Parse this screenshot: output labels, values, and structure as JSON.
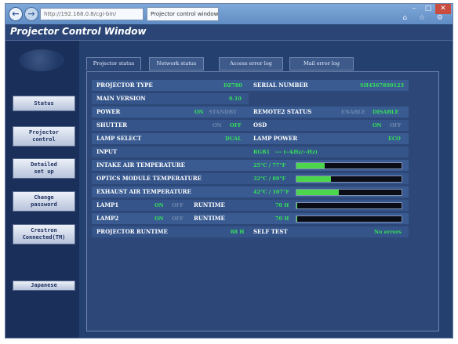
{
  "browser": {
    "address": "http://192.168.0.8/cgi-bin/",
    "tab_title": "Projector control window",
    "back_glyph": "←",
    "forward_glyph": "→",
    "minimize_glyph": "–",
    "maximize_glyph": "□",
    "close_glyph": "✕",
    "tool_glyphs": "⌂ ☆ ⚙"
  },
  "window_title": "Projector Control Window",
  "sidebar": {
    "buttons": [
      {
        "label": "Status"
      },
      {
        "label": "Projector\ncontrol"
      },
      {
        "label": "Detailed\nset up"
      },
      {
        "label": "Change\npassword"
      },
      {
        "label": "Crestron\nConnected(TM)"
      },
      {
        "label": "Japanese"
      }
    ]
  },
  "tabs": [
    "Projector status",
    "Network status",
    "Access error log",
    "Mail error log"
  ],
  "status": {
    "projector_type": {
      "label": "PROJECTOR TYPE",
      "value": "DZ780"
    },
    "serial_number": {
      "label": "SERIAL NUMBER",
      "value": "SH4567890123"
    },
    "main_version": {
      "label": "MAIN VERSION",
      "value": "0.10"
    },
    "power": {
      "label": "POWER",
      "on": "ON",
      "standby": "STANDBY"
    },
    "remote2": {
      "label": "REMOTE2 STATUS",
      "enable": "ENABLE",
      "disable": "DISABLE"
    },
    "shutter": {
      "label": "SHUTTER",
      "on": "ON",
      "off": "OFF"
    },
    "osd": {
      "label": "OSD",
      "on": "ON",
      "off": "OFF"
    },
    "lamp_select": {
      "label": "LAMP SELECT",
      "value": "DUAL"
    },
    "lamp_power": {
      "label": "LAMP POWER",
      "value": "ECO"
    },
    "input": {
      "label": "INPUT",
      "value": "RGB1",
      "freq": "--- (--kHz/--Hz)"
    },
    "intake": {
      "label": "INTAKE AIR TEMPERATURE",
      "value": "25°C / 77°F",
      "level": 0.27
    },
    "optics": {
      "label": "OPTICS MODULE TEMPERATURE",
      "value": "32°C / 89°F",
      "level": 0.33
    },
    "exhaust": {
      "label": "EXHAUST AIR TEMPERATURE",
      "value": "42°C / 107°F",
      "level": 0.4
    },
    "lamp1": {
      "label": "LAMP1",
      "on": "ON",
      "off": "OFF",
      "runtime_label": "RUNTIME",
      "runtime": "70 H",
      "level": 0.01
    },
    "lamp2": {
      "label": "LAMP2",
      "on": "ON",
      "off": "OFF",
      "runtime_label": "RUNTIME",
      "runtime": "70 H",
      "level": 0.01
    },
    "projector_runtime": {
      "label": "PROJECTOR RUNTIME",
      "value": "88 H"
    },
    "self_test": {
      "label": "SELF TEST",
      "value": "No errors"
    }
  },
  "colors": {
    "on_value": "#35e05a",
    "dim_value": "#6f87ad",
    "bar_fill": "#4cd64b"
  }
}
